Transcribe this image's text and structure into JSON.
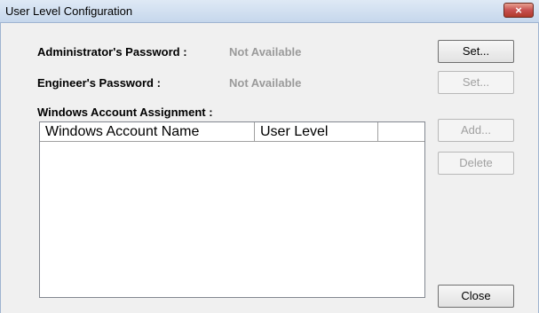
{
  "window": {
    "title": "User Level Configuration",
    "close_glyph": "×"
  },
  "admin": {
    "label": "Administrator's Password :",
    "value": "Not Available",
    "set_label": "Set..."
  },
  "engineer": {
    "label": "Engineer's Password :",
    "value": "Not Available",
    "set_label": "Set..."
  },
  "accounts": {
    "label": "Windows Account Assignment :",
    "columns": [
      "Windows Account Name",
      "User Level",
      ""
    ],
    "rows": []
  },
  "buttons": {
    "add": "Add...",
    "delete": "Delete",
    "close": "Close"
  }
}
